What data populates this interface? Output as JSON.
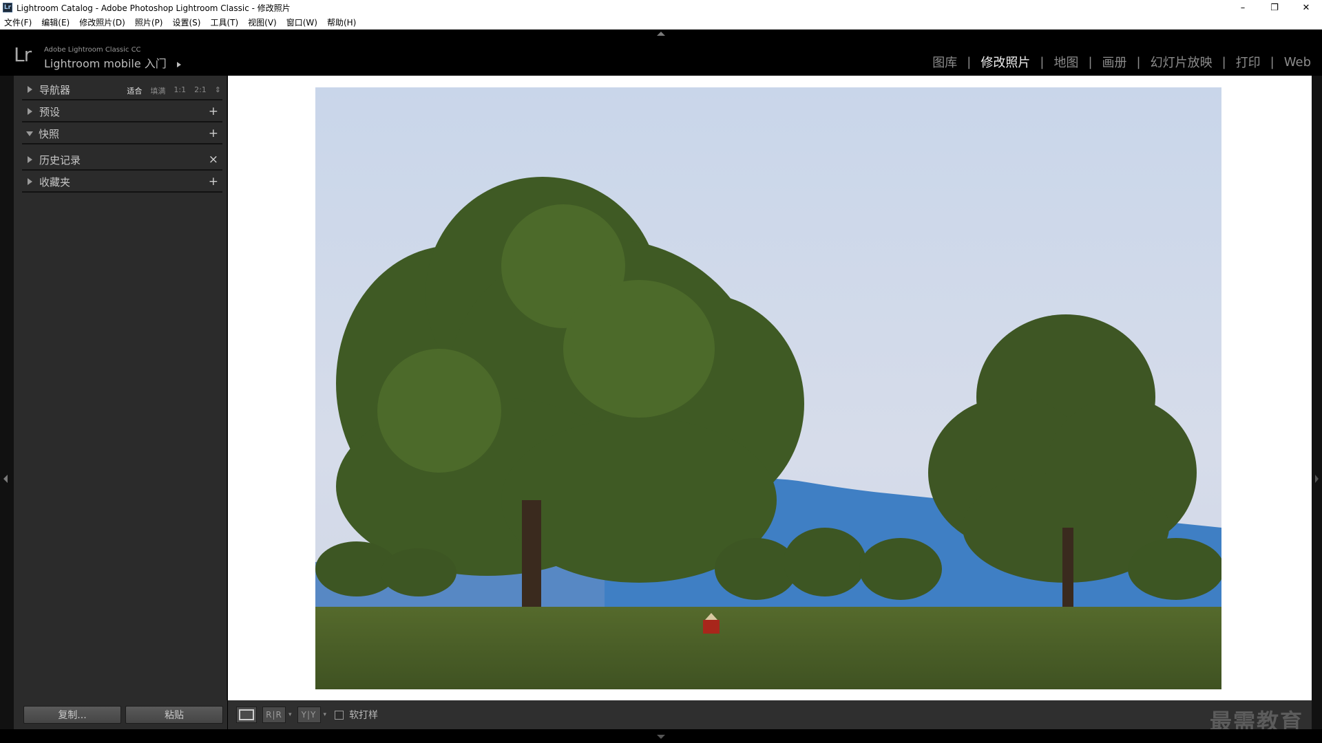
{
  "window": {
    "app_icon": "Lr",
    "title": "Lightroom Catalog - Adobe Photoshop Lightroom Classic - 修改照片",
    "minimize": "–",
    "restore": "❐",
    "close": "✕"
  },
  "menu": {
    "items": [
      "文件(F)",
      "编辑(E)",
      "修改照片(D)",
      "照片(P)",
      "设置(S)",
      "工具(T)",
      "视图(V)",
      "窗口(W)",
      "帮助(H)"
    ]
  },
  "identity": {
    "logo": "Lr",
    "product": "Adobe Lightroom Classic CC",
    "mobile": "Lightroom mobile 入门"
  },
  "modules": {
    "items": [
      "图库",
      "修改照片",
      "地图",
      "画册",
      "幻灯片放映",
      "打印",
      "Web"
    ],
    "active": "修改照片",
    "separator": "|"
  },
  "left_panel": {
    "navigator": {
      "label": "导航器",
      "zoom_options": [
        "适合",
        "填满",
        "1:1",
        "2:1"
      ],
      "zoom_active": "适合",
      "zoom_caret": "⇕"
    },
    "presets": {
      "label": "预设",
      "action": "+"
    },
    "snapshots": {
      "label": "快照",
      "action": "+"
    },
    "history": {
      "label": "历史记录",
      "action": "×"
    },
    "collections": {
      "label": "收藏夹",
      "action": "+"
    },
    "copy_button": "复制...",
    "paste_button": "粘贴"
  },
  "toolbar": {
    "before_after_lr": "R|R",
    "before_after_tb": "Y|Y",
    "caret": "▾",
    "softproof_label": "软打样",
    "softproof_checked": false
  },
  "watermark": "最需教育",
  "colors": {
    "active_module": "#f0f0f0",
    "inactive_module": "#8c8c8c",
    "panel_bg": "#2b2b2b",
    "canvas_bg": "#ffffff"
  }
}
